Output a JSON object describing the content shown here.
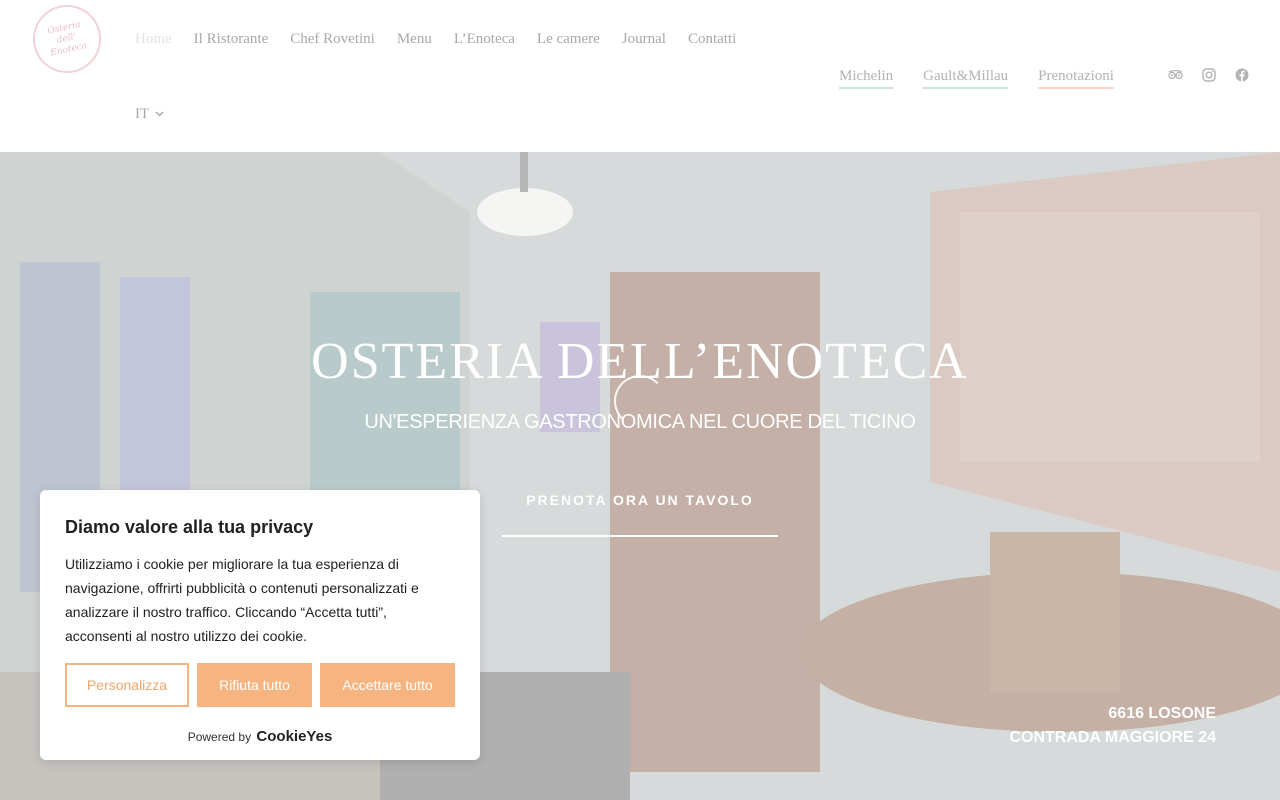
{
  "logo": {
    "text": "Osteria\ndell'\nEnoteca"
  },
  "nav": {
    "items": [
      {
        "label": "Home",
        "active": true
      },
      {
        "label": "Il Ristorante"
      },
      {
        "label": "Chef Rovetini"
      },
      {
        "label": "Menu"
      },
      {
        "label": "L’Enoteca"
      },
      {
        "label": "Le camere"
      },
      {
        "label": "Journal"
      },
      {
        "label": "Contatti"
      }
    ],
    "language": "IT"
  },
  "secondary_nav": {
    "michelin": "Michelin",
    "gaultmillau": "Gault&Millau",
    "reservations": "Prenotazioni"
  },
  "social_icons": [
    "tripadvisor-icon",
    "instagram-icon",
    "facebook-icon"
  ],
  "hero": {
    "title": "OSTERIA DELL’ENOTECA",
    "subtitle": "UN'ESPERIENZA GASTRONOMICA NEL CUORE DEL TICINO",
    "cta": "PRENOTA ORA UN TAVOLO",
    "address_line1": "6616 LOSONE",
    "address_line2": "CONTRADA MAGGIORE 24"
  },
  "cookie": {
    "title": "Diamo valore alla tua privacy",
    "body": "Utilizziamo i cookie per migliorare la tua esperienza di navigazione, offrirti pubblicità o contenuti personalizzati e analizzare il nostro traffico. Cliccando “Accetta tutti”, acconsenti al nostro utilizzo dei cookie.",
    "customize": "Personalizza",
    "reject": "Rifiuta tutto",
    "accept": "Accettare tutto",
    "powered_by": "Powered by",
    "brand": "CookieYes"
  },
  "colors": {
    "accent": "#f6b580",
    "nav_text": "#a8a8a8"
  }
}
